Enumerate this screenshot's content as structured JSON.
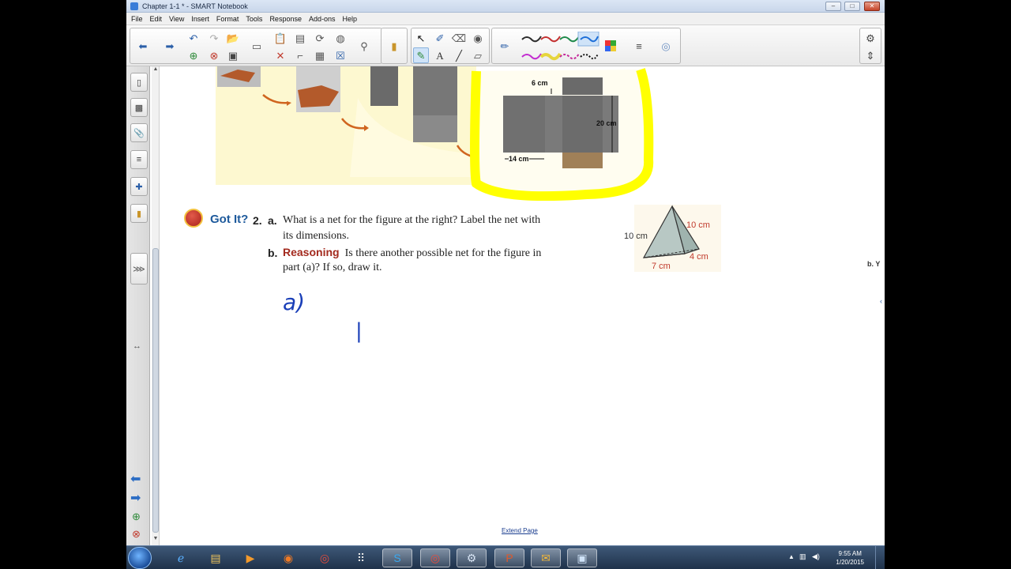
{
  "window": {
    "title": "Chapter 1-1 * - SMART Notebook",
    "minimize": "–",
    "maximize": "□",
    "close": "✕"
  },
  "menu": [
    "File",
    "Edit",
    "View",
    "Insert",
    "Format",
    "Tools",
    "Response",
    "Add-ons",
    "Help"
  ],
  "toolbar": {
    "icons": [
      "back-arrow-icon",
      "forward-arrow-icon",
      "undo-icon",
      "redo-icon",
      "open-icon",
      "add-page-icon",
      "delete-page-icon",
      "save-icon",
      "screen-shade-icon",
      "paste-icon",
      "cut-icon",
      "screen-capture-icon",
      "document-camera-icon",
      "table-icon",
      "delete-icon",
      "full-screen-icon",
      "response-icon",
      "select-icon",
      "pens-icon",
      "creative-pen-icon",
      "eraser-icon",
      "lines-icon",
      "shapes-icon",
      "text-icon",
      "fill-icon",
      "properties-icon",
      "color-palette-icon",
      "move-toolbar-icon",
      "settings-gear-icon",
      "toolbar-swap-icon"
    ],
    "pen_colors": [
      "#2d2d2d",
      "#c43030",
      "#1f8a4a",
      "#1e6fd8",
      "#c22bd0",
      "#e6d53c",
      "#c5289a",
      "#111111"
    ]
  },
  "side_tabs": [
    "page-sorter-icon",
    "gallery-icon",
    "attachments-icon",
    "properties-icon",
    "addons-icon",
    "response-icon"
  ],
  "graphic": {
    "label_6cm": "6 cm",
    "label_20cm": "20 cm",
    "label_14cm": "14 cm",
    "highlight_color": "#ffff00"
  },
  "problem": {
    "got_it": "Got It?",
    "number": "2.",
    "part_a_letter": "a.",
    "part_a_line1": "What is a net for the figure at the right? Label the net with",
    "part_a_line2": "its dimensions.",
    "part_b_letter": "b.",
    "reasoning": "Reasoning",
    "part_b_line1": "Is there another possible net for the figure in",
    "part_b_line2": "part (a)? If so, draw it."
  },
  "figure_labels": {
    "left": "10 cm",
    "right": "10 cm",
    "depth": "4 cm",
    "base": "7 cm"
  },
  "handwriting": {
    "answer_a": "a)",
    "stroke": "|"
  },
  "edge_text": "b. Y",
  "extend_page": "Extend Page",
  "taskbar": {
    "apps": [
      "ie-icon",
      "file-explorer-icon",
      "media-player-icon",
      "firefox-icon",
      "chrome-icon",
      "app-grid-icon",
      "skype-icon",
      "chrome-profile-icon",
      "smart-notebook-icon",
      "powerpoint-icon",
      "outlook-icon",
      "notebook-doc-icon"
    ],
    "time": "9:55 AM",
    "date": "1/20/2015"
  }
}
